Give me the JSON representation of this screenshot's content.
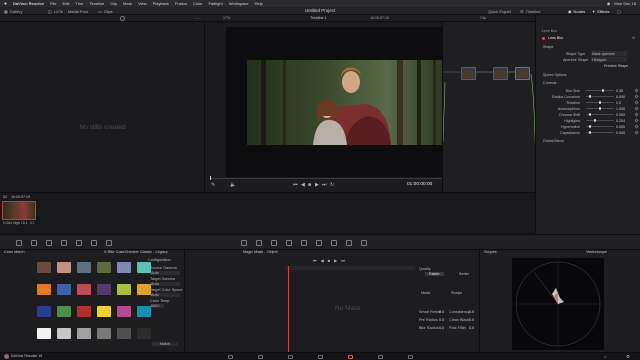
{
  "menubar": {
    "app": "DaVinci Resolve",
    "items": [
      "File",
      "Edit",
      "Trim",
      "Timeline",
      "Clip",
      "Mark",
      "View",
      "Playback",
      "Fusion",
      "Color",
      "Fairlight",
      "Workspace",
      "Help"
    ],
    "clock": "Mon Dec 18"
  },
  "toolbar": {
    "gallery": "Gallery",
    "luts": "LUTs",
    "media_pool": "Media Pool",
    "clips": "Clips",
    "project_title": "Untitled Project",
    "quick_export": "Quick Export",
    "timeline_label": "Timeline",
    "nodes": "Nodes",
    "effects": "Effects",
    "lightbox": "Lightbox"
  },
  "viewer_header": {
    "zoom": "17%",
    "timeline_name": "Timeline 1",
    "timecode_top": "16:06:57:19",
    "clip_menu": "Clip"
  },
  "gallery": {
    "empty_message": "No stills created"
  },
  "viewer": {
    "timecode": "01:00:00:00"
  },
  "inspector": {
    "tabs": [
      "Library",
      "Settings"
    ],
    "breadcrumb": "Lens Blur",
    "effect_name": "Lens Blur",
    "section_shape": "Shape",
    "shape_type_label": "Shape Type",
    "shape_type_value": "Mask aperture",
    "aperture_label": "Aperture Shape",
    "aperture_value": "Hexagon",
    "preview_shape": "Preview Shape",
    "section_speed": "Speed Options",
    "section_controls": "Controls",
    "params": [
      {
        "label": "Blur Size",
        "value": "0.35",
        "pos": 0.6
      },
      {
        "label": "Radius Curvature",
        "value": "0.000",
        "pos": 0.1
      },
      {
        "label": "Rotation",
        "value": "0.0",
        "pos": 0.5
      },
      {
        "label": "Anamorphism",
        "value": "1.000",
        "pos": 0.5
      },
      {
        "label": "Chroma Shift",
        "value": "0.000",
        "pos": 0.1
      },
      {
        "label": "Highlights",
        "value": "0.204",
        "pos": 0.3
      },
      {
        "label": "Hyperbolize",
        "value": "0.000",
        "pos": 0.1
      },
      {
        "label": "Capacitance",
        "value": "0.000",
        "pos": 0.1
      }
    ],
    "global_blend": "Global Blend"
  },
  "clips": {
    "timecode": "16:06:57:19",
    "clip_number": "01",
    "track": "V1",
    "codec": "H.264 High L5.1"
  },
  "colormatch": {
    "title": "Color Match",
    "chart_title": "X-Rite ColorChecker Classic - Legacy",
    "config_title": "Configuration",
    "source_gamma_label": "Source Gamma",
    "source_gamma": "Auto",
    "target_gamma_label": "Target Gamma",
    "target_gamma": "Auto",
    "target_cs_label": "Target Color Space",
    "target_cs": "Auto",
    "color_temp_label": "Color Temp",
    "color_temp": "6500",
    "match_button": "Match",
    "swatches": [
      "#6b4a3a",
      "#c29080",
      "#5e7080",
      "#5e6a40",
      "#8288b4",
      "#5ec0b0",
      "#e07a28",
      "#4060a8",
      "#c04a58",
      "#5a3a6a",
      "#a8c040",
      "#e0a030",
      "#2a3e90",
      "#4c9048",
      "#b03030",
      "#eed030",
      "#b84a90",
      "#1890b0",
      "#f2f2f2",
      "#c8c8c8",
      "#a0a0a0",
      "#787878",
      "#505050",
      "#2c2c2c"
    ]
  },
  "magicmask": {
    "title": "Magic Mask - Object",
    "no_mask": "No Mask",
    "quality_label": "Quality",
    "quality_options": [
      "Faster",
      "Better"
    ],
    "mode_labels": [
      "Mode",
      "Shape"
    ],
    "fields": [
      {
        "label": "Smart Refine",
        "value": "0.0"
      },
      {
        "label": "Consistency",
        "value": "0.0"
      },
      {
        "label": "Pre Radius",
        "value": "0.0"
      },
      {
        "label": "Clean Black",
        "value": "0.0"
      },
      {
        "label": "Blur Radius",
        "value": "0.0"
      },
      {
        "label": "Post Filter",
        "value": "0.0"
      }
    ]
  },
  "scopes": {
    "title": "Scopes",
    "mode": "Vectorscope"
  },
  "pagebar": {
    "app_name": "DaVinci Resolve 19"
  }
}
